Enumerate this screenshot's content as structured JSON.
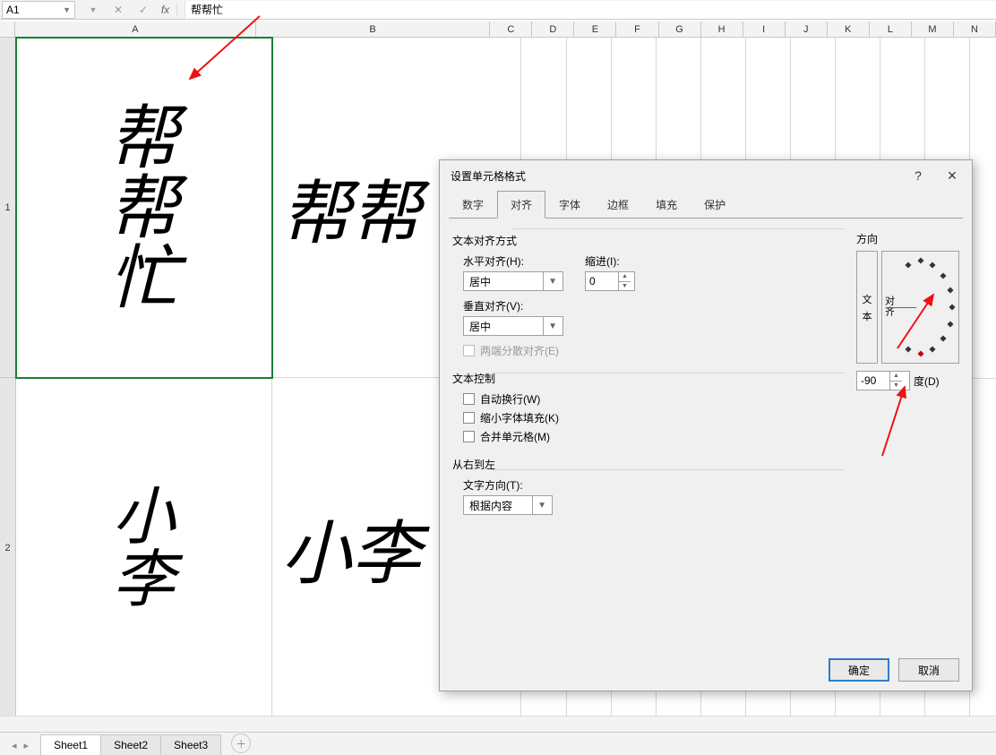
{
  "formula_bar": {
    "cell_ref": "A1",
    "formula_value": "帮帮忙"
  },
  "columns": [
    "A",
    "B",
    "C",
    "D",
    "E",
    "F",
    "G",
    "H",
    "I",
    "J",
    "K",
    "L",
    "M",
    "N"
  ],
  "rows": [
    "1",
    "2"
  ],
  "cells": {
    "A1": "帮帮忙",
    "B1": "帮帮",
    "A2": "小李",
    "B2": "小李"
  },
  "sheet_tabs": {
    "items": [
      "Sheet1",
      "Sheet2",
      "Sheet3"
    ],
    "active": 0
  },
  "dialog": {
    "title": "设置单元格格式",
    "help": "?",
    "close": "×",
    "tabs": [
      "数字",
      "对齐",
      "字体",
      "边框",
      "填充",
      "保护"
    ],
    "active_tab": 1,
    "alignment": {
      "section_align": "文本对齐方式",
      "h_align_label": "水平对齐(H):",
      "h_align_value": "居中",
      "v_align_label": "垂直对齐(V):",
      "v_align_value": "居中",
      "indent_label": "缩进(I):",
      "indent_value": "0",
      "justify_label": "两端分散对齐(E)",
      "section_control": "文本控制",
      "wrap_label": "自动换行(W)",
      "shrink_label": "缩小字体填充(K)",
      "merge_label": "合并单元格(M)",
      "section_rtl": "从右到左",
      "textdir_label": "文字方向(T):",
      "textdir_value": "根据内容",
      "orientation_label": "方向",
      "orient_vert_chars": "文本",
      "orient_dial_chars": "对齐",
      "degree_value": "-90",
      "degree_unit": "度(D)"
    },
    "buttons": {
      "ok": "确定",
      "cancel": "取消"
    }
  }
}
